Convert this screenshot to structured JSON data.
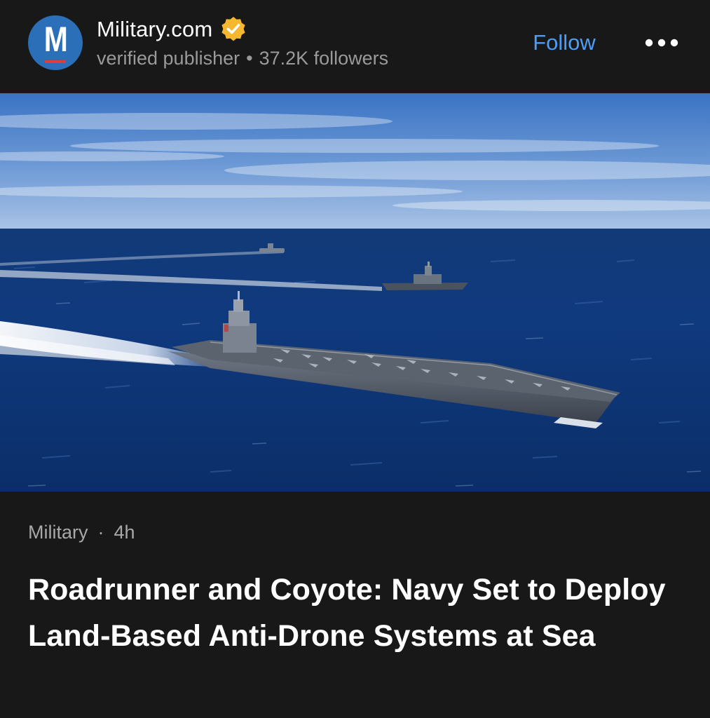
{
  "publisher": {
    "logo_letter": "M",
    "name": "Military.com",
    "badge_icon": "verified-badge-icon",
    "badge_color": "#f5b82e",
    "subtitle": "verified publisher",
    "separator": "•",
    "followers": "37.2K followers"
  },
  "actions": {
    "follow_label": "Follow",
    "more_icon": "more-horizontal-icon",
    "accent_color": "#4e9cf5"
  },
  "hero": {
    "image_subject": "aircraft carrier with escort ships at sea"
  },
  "article": {
    "category": "Military",
    "separator": "·",
    "age": "4h",
    "headline": "Roadrunner and Coyote: Navy Set to Deploy Land-Based Anti-Drone Systems at Sea"
  }
}
